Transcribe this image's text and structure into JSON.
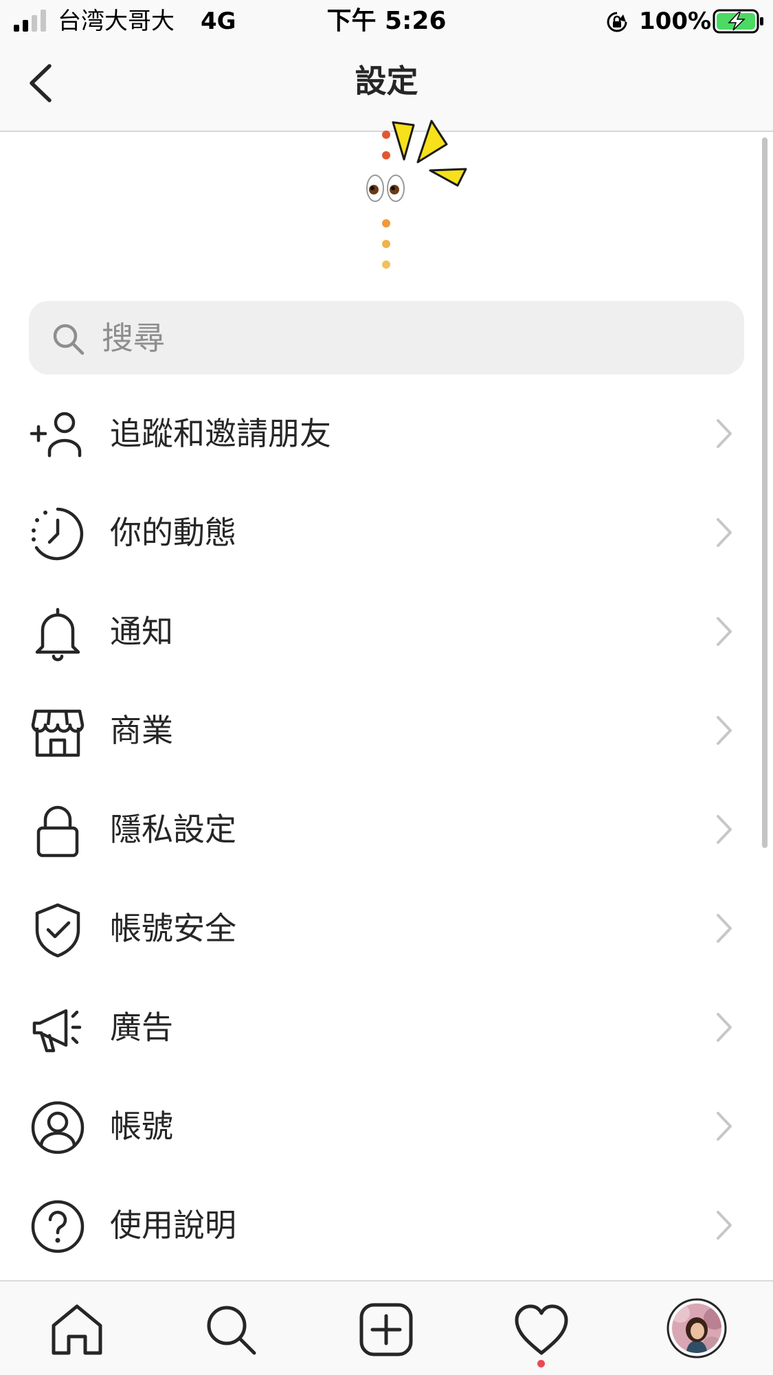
{
  "status_bar": {
    "carrier": "台湾大哥大",
    "network": "4G",
    "time": "下午 5:26",
    "battery_percent": "100%",
    "battery_level": 1.0,
    "battery_charging": true
  },
  "nav": {
    "title": "設定",
    "back_icon": "chevron-left-icon"
  },
  "sticker": {
    "icon": "eyes-emoji-sticker"
  },
  "search": {
    "placeholder": "搜尋",
    "icon": "search-icon"
  },
  "menu": {
    "items": [
      {
        "label": "追蹤和邀請朋友",
        "icon": "add-person-icon"
      },
      {
        "label": "你的動態",
        "icon": "activity-clock-icon"
      },
      {
        "label": "通知",
        "icon": "bell-icon"
      },
      {
        "label": "商業",
        "icon": "shop-icon"
      },
      {
        "label": "隱私設定",
        "icon": "lock-icon"
      },
      {
        "label": "帳號安全",
        "icon": "shield-check-icon"
      },
      {
        "label": "廣告",
        "icon": "megaphone-icon"
      },
      {
        "label": "帳號",
        "icon": "user-circle-icon"
      },
      {
        "label": "使用說明",
        "icon": "help-circle-icon"
      }
    ]
  },
  "tab_bar": {
    "tabs": [
      {
        "name": "home",
        "icon": "home-icon"
      },
      {
        "name": "search",
        "icon": "search-icon"
      },
      {
        "name": "new-post",
        "icon": "plus-square-icon"
      },
      {
        "name": "activity",
        "icon": "heart-icon",
        "has_notification": true
      },
      {
        "name": "profile",
        "icon": "avatar"
      }
    ]
  },
  "colors": {
    "text": "#262626",
    "secondary_text": "#8e8e8e",
    "search_bg": "#efefef",
    "bar_bg": "#f9f9f9",
    "notification_dot": "#ed4956",
    "battery_fill": "#4cd964"
  }
}
